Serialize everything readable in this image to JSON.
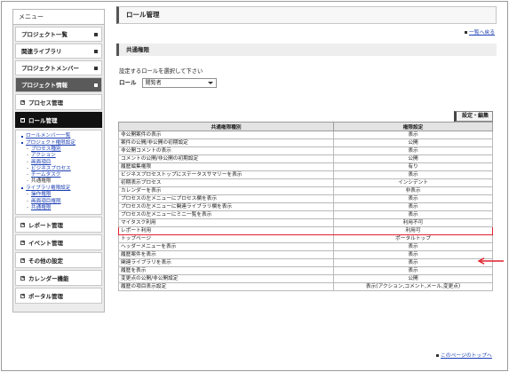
{
  "sidebar": {
    "title": "メニュー",
    "top_items": [
      {
        "label": "プロジェクト一覧"
      },
      {
        "label": "関連ライブラリ"
      },
      {
        "label": "プロジェクトメンバー"
      },
      {
        "label": "プロジェクト情報"
      }
    ],
    "sub_items": [
      {
        "label": "プロセス管理"
      },
      {
        "label": "ロール管理"
      }
    ],
    "tree": {
      "role_members": "ロールメンバー一覧",
      "project_perm": "プロジェクト権限設定",
      "project_children": [
        "プロセス種別",
        "アクション",
        "画面項目",
        "ビジネスプロセス",
        "チームタスク",
        "共通権限"
      ],
      "library_perm": "ライブラリ権限設定",
      "library_children": [
        "操作権限",
        "画面項目権限",
        "共通権限"
      ]
    },
    "bottom_items": [
      {
        "label": "レポート管理"
      },
      {
        "label": "イベント管理"
      },
      {
        "label": "その他の設定"
      },
      {
        "label": "カレンダー機能"
      },
      {
        "label": "ポータル管理"
      }
    ]
  },
  "main": {
    "page_title": "ロール管理",
    "back_link": "一覧へ戻る",
    "section_title": "共通権限",
    "prompt": "設定するロールを選択して下さい",
    "role_label": "ロール",
    "role_value": "閲覧者",
    "edit_button": "設定・編集",
    "table": {
      "headers": [
        "共通権限種別",
        "権限設定"
      ],
      "rows": [
        [
          "非公開案件の表示",
          "表示"
        ],
        [
          "案件の公開/非公開の初期設定",
          "公開"
        ],
        [
          "非公開コメントの表示",
          "表示"
        ],
        [
          "コメントの公開/非公開の初期設定",
          "公開"
        ],
        [
          "履歴編集権限",
          "有り"
        ],
        [
          "ビジネスプロセストップにステータスサマリーを表示",
          "表示"
        ],
        [
          "初期表示プロセス",
          "インシデント"
        ],
        [
          "カレンダーを表示",
          "非表示"
        ],
        [
          "プロセスの左メニューにプロセス欄を表示",
          "表示"
        ],
        [
          "プロセスの左メニューに関連ライブラリ欄を表示",
          "表示"
        ],
        [
          "プロセスの左メニューにミニ一覧を表示",
          "表示"
        ],
        [
          "マイタスク利用",
          "利用不可"
        ],
        [
          "レポート利用",
          "利用可"
        ],
        [
          "トップページ",
          "ポータルトップ"
        ],
        [
          "ヘッダーメニューを表示",
          "表示"
        ],
        [
          "履歴案件を表示",
          "表示"
        ],
        [
          "関連ライブラリを表示",
          "表示"
        ],
        [
          "履歴を表示",
          "表示"
        ],
        [
          "変更点の公開/非公開設定",
          "公開"
        ],
        [
          "履歴の項目表示設定",
          "表示(アクション,コメント,メール,変更点)"
        ]
      ],
      "highlight_row_index": 12
    },
    "top_link": "このページのトップへ"
  },
  "colors": {
    "highlight": "#e0202c",
    "link": "#1b3fb3"
  }
}
